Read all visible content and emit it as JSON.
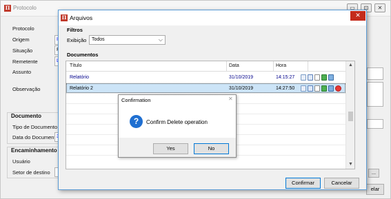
{
  "background_window": {
    "title": "Protocolo",
    "controls": {
      "minimize": "▭",
      "maximize": "⊡",
      "close": "✕"
    },
    "labels": {
      "protocolo": "Protocolo",
      "origem": "Origem",
      "situacao": "Situação",
      "remetente": "Remetente",
      "assunto": "Assunto",
      "observacao": "Observação"
    },
    "fields": {
      "origem_partial": "I",
      "situacao_partial": "P",
      "remetente_partial": "L"
    },
    "documento": {
      "section_title": "Documento",
      "tipo_label": "Tipo de Documento",
      "data_label": "Data do Documento",
      "data_partial": "3"
    },
    "encaminhamento": {
      "section_title": "Encaminhamento",
      "usuario_label": "Usuário",
      "setor_label": "Setor de destino"
    },
    "ellipsis_button": "...",
    "partial_button": "elar"
  },
  "dialog": {
    "title": "Arquivos",
    "close_glyph": "✕",
    "filtros": {
      "group_title": "Filtros",
      "exibicao_label": "Exibição",
      "exibicao_value": "Todos"
    },
    "documentos": {
      "group_title": "Documentos",
      "columns": [
        "Título",
        "Data",
        "Hora"
      ],
      "rows": [
        {
          "titulo": "Relatório",
          "data": "31/10/2019",
          "hora": "14:15:27",
          "selected": false,
          "has_delete": false
        },
        {
          "titulo": "Relatório 2",
          "data": "31/10/2019",
          "hora": "14:27:50",
          "selected": true,
          "has_delete": true
        }
      ],
      "row_action_icons": [
        "search-doc-icon",
        "view-doc-icon",
        "document-icon",
        "download-icon",
        "image-icon",
        "delete-icon"
      ]
    },
    "buttons": {
      "confirm": "Confirmar",
      "cancel": "Cancelar"
    }
  },
  "confirmation": {
    "title": "Confirmation",
    "close_glyph": "✕",
    "icon": "question-icon",
    "message": "Confirm Delete operation",
    "yes_label": "Yes",
    "no_label": "No"
  },
  "colors": {
    "accent": "#0078d7",
    "close_red": "#c42b1c",
    "link_blue": "#00008b",
    "selection": "#cce4f7",
    "question_icon": "#1f6fd1"
  }
}
